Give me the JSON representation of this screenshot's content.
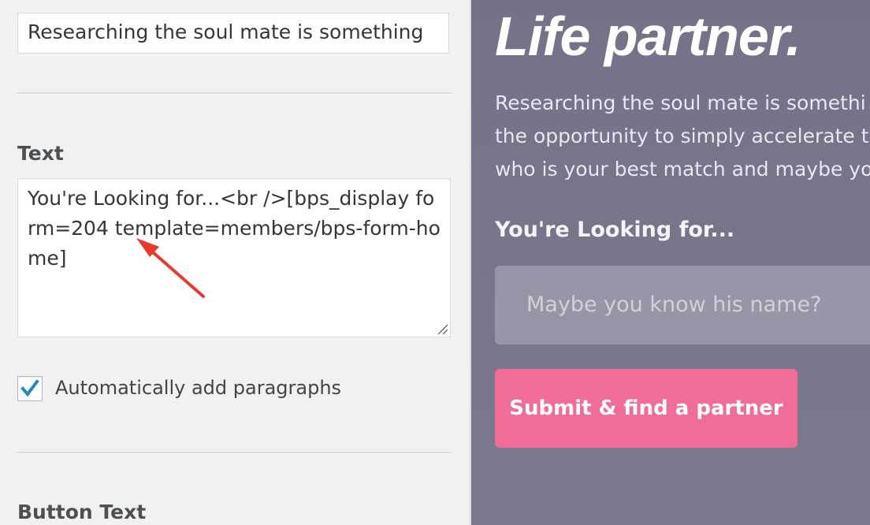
{
  "left_panel": {
    "title_field_value": "Researching the soul mate is something",
    "text_label": "Text",
    "text_field_value": "You're Looking for...<br />[bps_display form=204 template=members/bps-form-home]",
    "auto_paragraphs_label": "Automatically add paragraphs",
    "auto_paragraphs_checked": true,
    "button_text_label": "Button Text"
  },
  "preview": {
    "title": "Life partner.",
    "body_lines": [
      "Researching the soul mate is somethi",
      "the opportunity to simply accelerate t",
      "who is your best match and maybe yo"
    ],
    "looking_label": "You're Looking for...",
    "name_placeholder": "Maybe you know his name?",
    "submit_label": "Submit & find a partner"
  },
  "colors": {
    "annotation_arrow": "#e8392e",
    "checkmark": "#1e8cbe",
    "submit_button": "#ef6d96",
    "preview_background": "#787489"
  },
  "icons": {
    "checkbox": "checkmark-icon",
    "annotation": "red-arrow-icon",
    "resize": "resize-grip-icon"
  }
}
